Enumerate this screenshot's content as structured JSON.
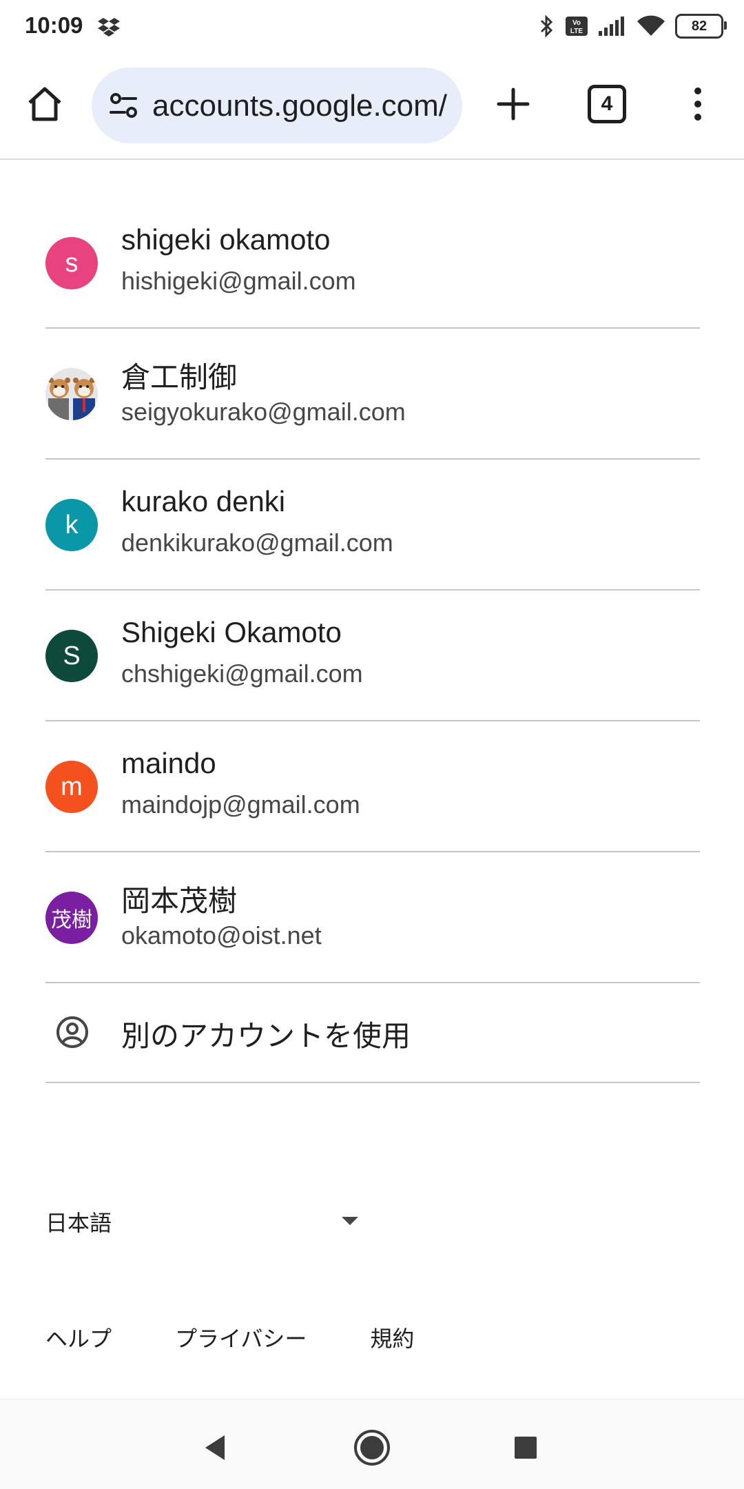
{
  "status_bar": {
    "time": "10:09",
    "battery": "82"
  },
  "browser": {
    "url": "accounts.google.com/",
    "tab_count": "4"
  },
  "accounts": [
    {
      "name": "shigeki okamoto",
      "email": "hishigeki@gmail.com",
      "avatar_text": "s",
      "avatar_color": "#e8437f"
    },
    {
      "name": "倉工制御",
      "email": "seigyokurako@gmail.com",
      "avatar_text": "",
      "avatar_color": "#e6e6e6"
    },
    {
      "name": "kurako denki",
      "email": "denkikurako@gmail.com",
      "avatar_text": "k",
      "avatar_color": "#0a97a8"
    },
    {
      "name": "Shigeki Okamoto",
      "email": "chshigeki@gmail.com",
      "avatar_text": "S",
      "avatar_color": "#0d4a3c"
    },
    {
      "name": "maindo",
      "email": "maindojp@gmail.com",
      "avatar_text": "m",
      "avatar_color": "#f4511e"
    },
    {
      "name": "岡本茂樹",
      "email": "okamoto@oist.net",
      "avatar_text": "茂樹",
      "avatar_color": "#7b1fa2"
    }
  ],
  "use_other_account": "別のアカウントを使用",
  "language": {
    "selected": "日本語"
  },
  "footer": {
    "help": "ヘルプ",
    "privacy": "プライバシー",
    "terms": "規約"
  }
}
